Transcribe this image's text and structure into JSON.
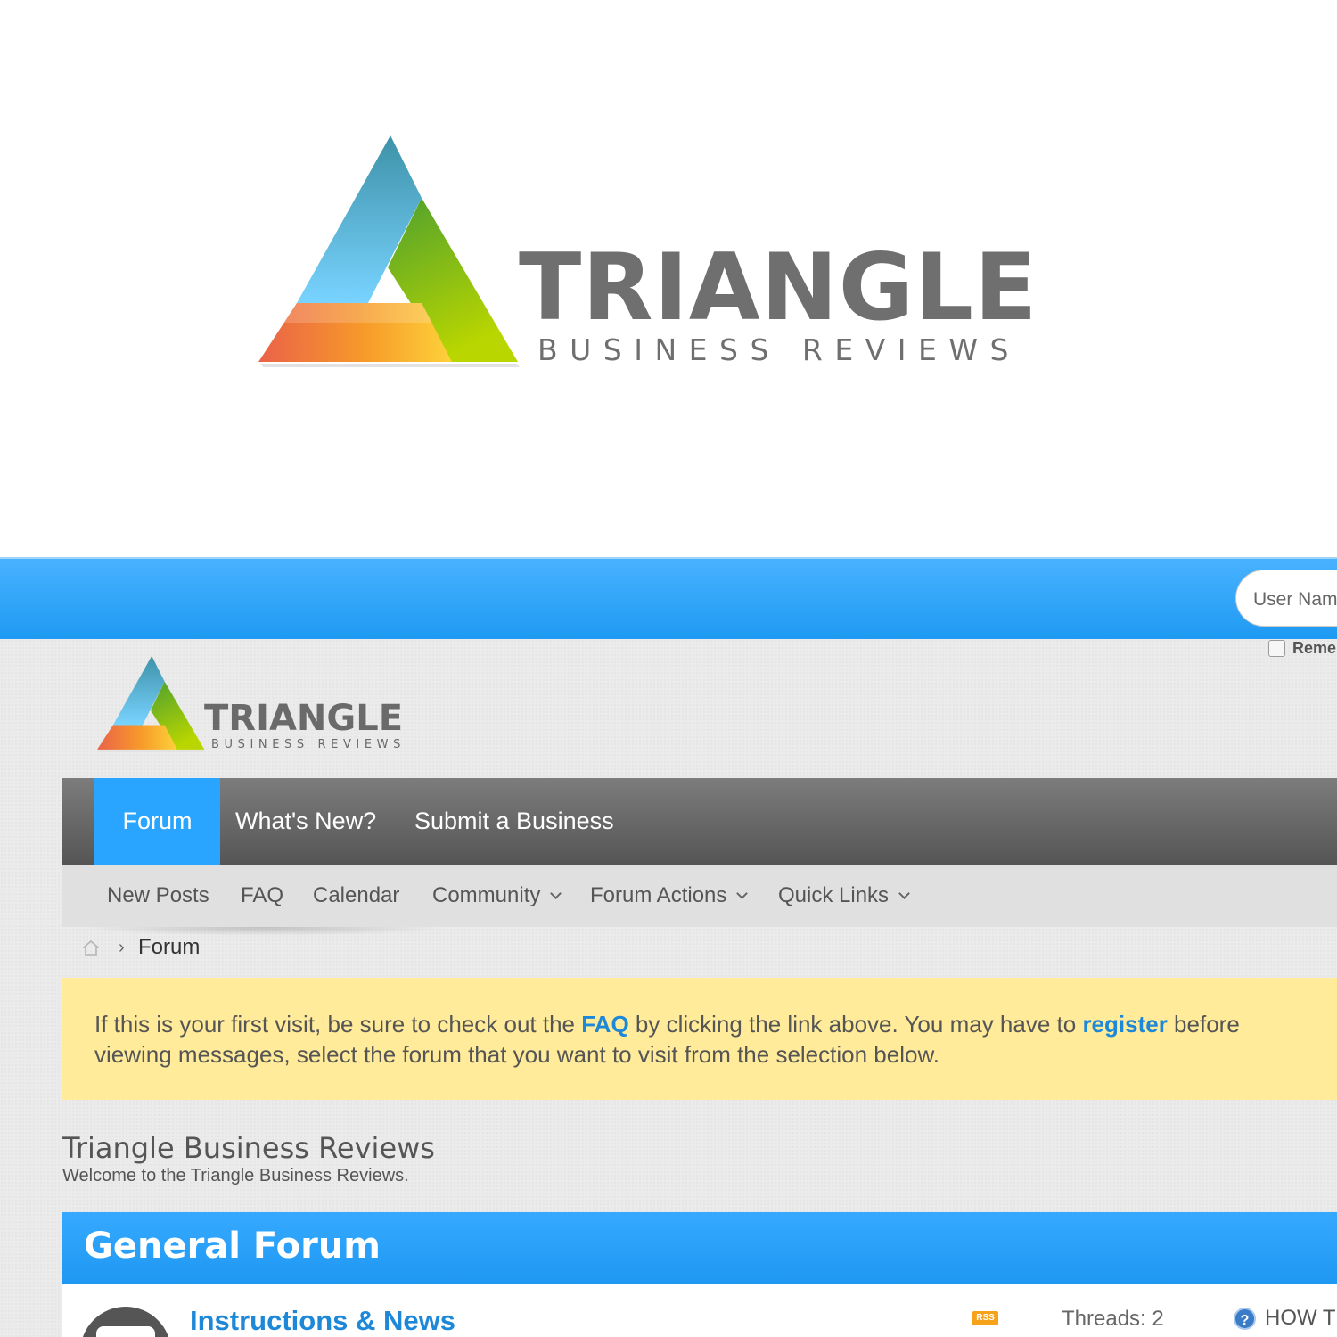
{
  "brand": {
    "name": "TRIANGLE",
    "tagline": "BUSINESS REVIEWS",
    "colors": {
      "blue": "#5cc4f5",
      "green": "#8ccc1e",
      "orange": "#f08a2a",
      "yellow": "#fcc530",
      "gray": "#6f6f6f"
    }
  },
  "login": {
    "username_placeholder": "User Nam",
    "remember_label": "Reme"
  },
  "nav": {
    "tabs": [
      {
        "label": "Forum",
        "active": true
      },
      {
        "label": "What's New?"
      },
      {
        "label": "Submit a Business"
      }
    ]
  },
  "subnav": {
    "items": [
      {
        "label": "New Posts"
      },
      {
        "label": "FAQ"
      },
      {
        "label": "Calendar"
      },
      {
        "label": "Community",
        "dropdown": true
      },
      {
        "label": "Forum Actions",
        "dropdown": true
      },
      {
        "label": "Quick Links",
        "dropdown": true
      }
    ]
  },
  "breadcrumb": {
    "separator": "›",
    "current": "Forum"
  },
  "notice": {
    "text_1": "If this is your first visit, be sure to check out the ",
    "faq_link": "FAQ",
    "text_2": " by clicking the link above. You may have to ",
    "register_link": "register",
    "text_3": " before",
    "line_2": "viewing messages, select the forum that you want to visit from the selection below."
  },
  "site": {
    "title": "Triangle Business Reviews",
    "description": "Welcome to the Triangle Business Reviews."
  },
  "forum_section": {
    "title": "General Forum",
    "forums": [
      {
        "name": "Instructions & News",
        "rss_label": "RSS",
        "threads": "Threads: 2",
        "last_post": "HOW T",
        "help_glyph": "?"
      }
    ]
  }
}
